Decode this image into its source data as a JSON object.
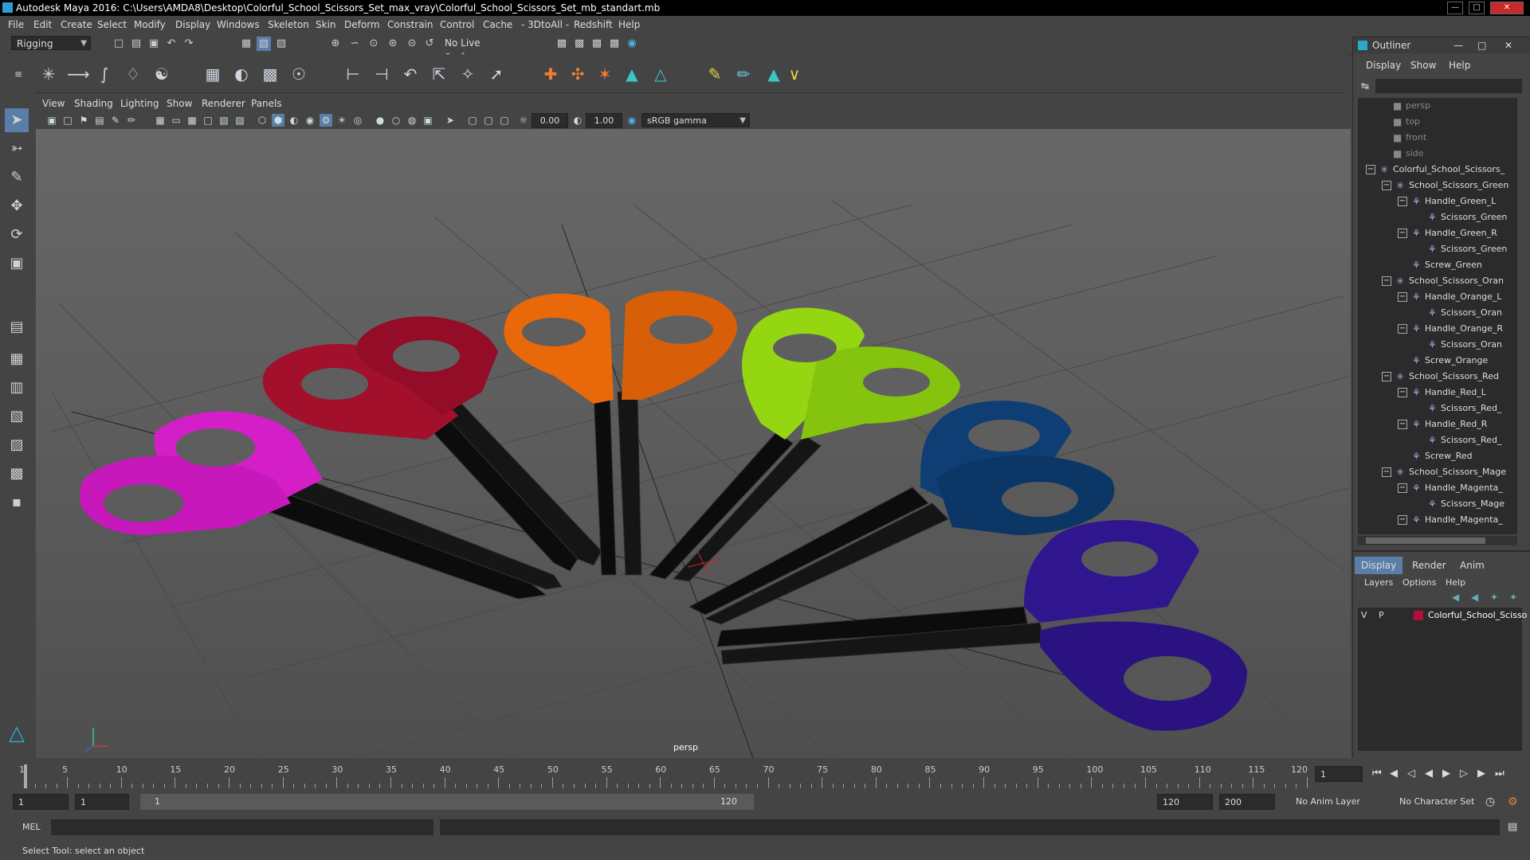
{
  "titlebar": {
    "title": "Autodesk Maya 2016: C:\\Users\\AMDA8\\Desktop\\Colorful_School_Scissors_Set_max_vray\\Colorful_School_Scissors_Set_mb_standart.mb"
  },
  "menus": [
    "File",
    "Edit",
    "Create",
    "Select",
    "Modify",
    "Display",
    "Windows",
    "Skeleton",
    "Skin",
    "Deform",
    "Constrain",
    "Control",
    "Cache",
    "- 3DtoAll -",
    "Redshift",
    "Help"
  ],
  "status": {
    "menuset": "Rigging",
    "live_surface": "No Live Surface"
  },
  "viewport": {
    "menus": [
      "View",
      "Shading",
      "Lighting",
      "Show",
      "Renderer",
      "Panels"
    ],
    "exposure": "0.00",
    "gamma": "1.00",
    "colorspace": "sRGB gamma",
    "camera_label": "persp"
  },
  "outliner": {
    "title": "Outliner",
    "menus": [
      "Display",
      "Show",
      "Help"
    ],
    "items": [
      {
        "label": "persp",
        "indent": 0,
        "type": "camera"
      },
      {
        "label": "top",
        "indent": 0,
        "type": "camera"
      },
      {
        "label": "front",
        "indent": 0,
        "type": "camera"
      },
      {
        "label": "side",
        "indent": 0,
        "type": "camera"
      },
      {
        "label": "Colorful_School_Scissors_",
        "indent": 0,
        "type": "group"
      },
      {
        "label": "School_Scissors_Green",
        "indent": 1,
        "type": "group"
      },
      {
        "label": "Handle_Green_L",
        "indent": 2,
        "type": "mesh"
      },
      {
        "label": "Scissors_Green",
        "indent": 3,
        "type": "mesh"
      },
      {
        "label": "Handle_Green_R",
        "indent": 2,
        "type": "mesh"
      },
      {
        "label": "Scissors_Green",
        "indent": 3,
        "type": "mesh"
      },
      {
        "label": "Screw_Green",
        "indent": 2,
        "type": "mesh"
      },
      {
        "label": "School_Scissors_Oran",
        "indent": 1,
        "type": "group"
      },
      {
        "label": "Handle_Orange_L",
        "indent": 2,
        "type": "mesh"
      },
      {
        "label": "Scissors_Oran",
        "indent": 3,
        "type": "mesh"
      },
      {
        "label": "Handle_Orange_R",
        "indent": 2,
        "type": "mesh"
      },
      {
        "label": "Scissors_Oran",
        "indent": 3,
        "type": "mesh"
      },
      {
        "label": "Screw_Orange",
        "indent": 2,
        "type": "mesh"
      },
      {
        "label": "School_Scissors_Red",
        "indent": 1,
        "type": "group"
      },
      {
        "label": "Handle_Red_L",
        "indent": 2,
        "type": "mesh"
      },
      {
        "label": "Scissors_Red_",
        "indent": 3,
        "type": "mesh"
      },
      {
        "label": "Handle_Red_R",
        "indent": 2,
        "type": "mesh"
      },
      {
        "label": "Scissors_Red_",
        "indent": 3,
        "type": "mesh"
      },
      {
        "label": "Screw_Red",
        "indent": 2,
        "type": "mesh"
      },
      {
        "label": "School_Scissors_Mage",
        "indent": 1,
        "type": "group"
      },
      {
        "label": "Handle_Magenta_",
        "indent": 2,
        "type": "mesh"
      },
      {
        "label": "Scissors_Mage",
        "indent": 3,
        "type": "mesh"
      },
      {
        "label": "Handle_Magenta_",
        "indent": 2,
        "type": "mesh"
      }
    ]
  },
  "layers": {
    "tabs": [
      "Display",
      "Render",
      "Anim"
    ],
    "menus": [
      "Layers",
      "Options",
      "Help"
    ],
    "row": {
      "v": "V",
      "p": "P",
      "name": "Colorful_School_Scisso",
      "color": "#b0103a"
    }
  },
  "timeline": {
    "ticks": [
      1,
      5,
      10,
      15,
      20,
      25,
      30,
      35,
      40,
      45,
      50,
      55,
      60,
      65,
      70,
      75,
      80,
      85,
      90,
      95,
      100,
      105,
      110,
      115,
      120
    ],
    "current_frame": "1"
  },
  "range": {
    "start": "1",
    "start2": "1",
    "slider_start": "1",
    "slider_end": "120",
    "end": "120",
    "end2": "200",
    "anim_layer": "No Anim Layer",
    "char_set": "No Character Set"
  },
  "mel": {
    "label": "MEL"
  },
  "help": {
    "text": "Select Tool: select an object"
  },
  "colors": {
    "magenta": "#d41fc8",
    "red": "#a2102c",
    "orange": "#e8680a",
    "green": "#95d612",
    "blue": "#0e3e74",
    "purple": "#2f168f"
  }
}
